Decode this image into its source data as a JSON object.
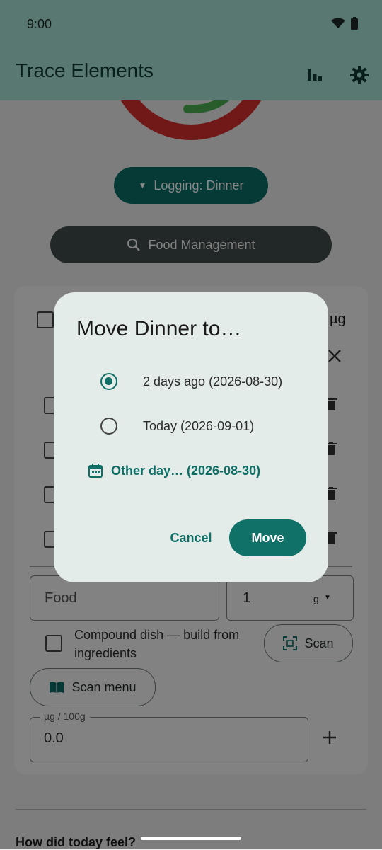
{
  "status": {
    "time": "9:00"
  },
  "app": {
    "title": "Trace Elements"
  },
  "icons": {
    "chart": "bar-chart-icon",
    "settings": "gear-icon",
    "dropdown": "caret-down-icon",
    "search": "search-icon",
    "calendar": "calendar-icon",
    "qr_scan": "qr-scan-icon",
    "book": "book-icon",
    "trash": "trash-icon",
    "close": "close-icon",
    "plus": "plus-icon"
  },
  "main": {
    "logging_button": "Logging: Dinner",
    "food_management_button": "Food Management",
    "card": {
      "header_unit_fragment": "µg",
      "food_placeholder": "Food",
      "quantity_value": "1",
      "quantity_unit": "g",
      "compound_label": "Compound dish — build from ingredients",
      "scan_label": "Scan",
      "scan_menu_label": "Scan menu",
      "ug_label": "µg / 100g",
      "ug_value": "0.0"
    },
    "footer_prompt": "How did today feel?"
  },
  "dialog": {
    "title": "Move Dinner to…",
    "options": [
      {
        "label": "2 days ago (2026-08-30)",
        "selected": true
      },
      {
        "label": "Today (2026-09-01)",
        "selected": false
      }
    ],
    "other_day": "Other day… (2026-08-30)",
    "cancel": "Cancel",
    "move": "Move"
  },
  "colors": {
    "primary": "#0f7168",
    "app_bar": "#a6e3d5",
    "dialog_surface": "#e3ece9"
  }
}
